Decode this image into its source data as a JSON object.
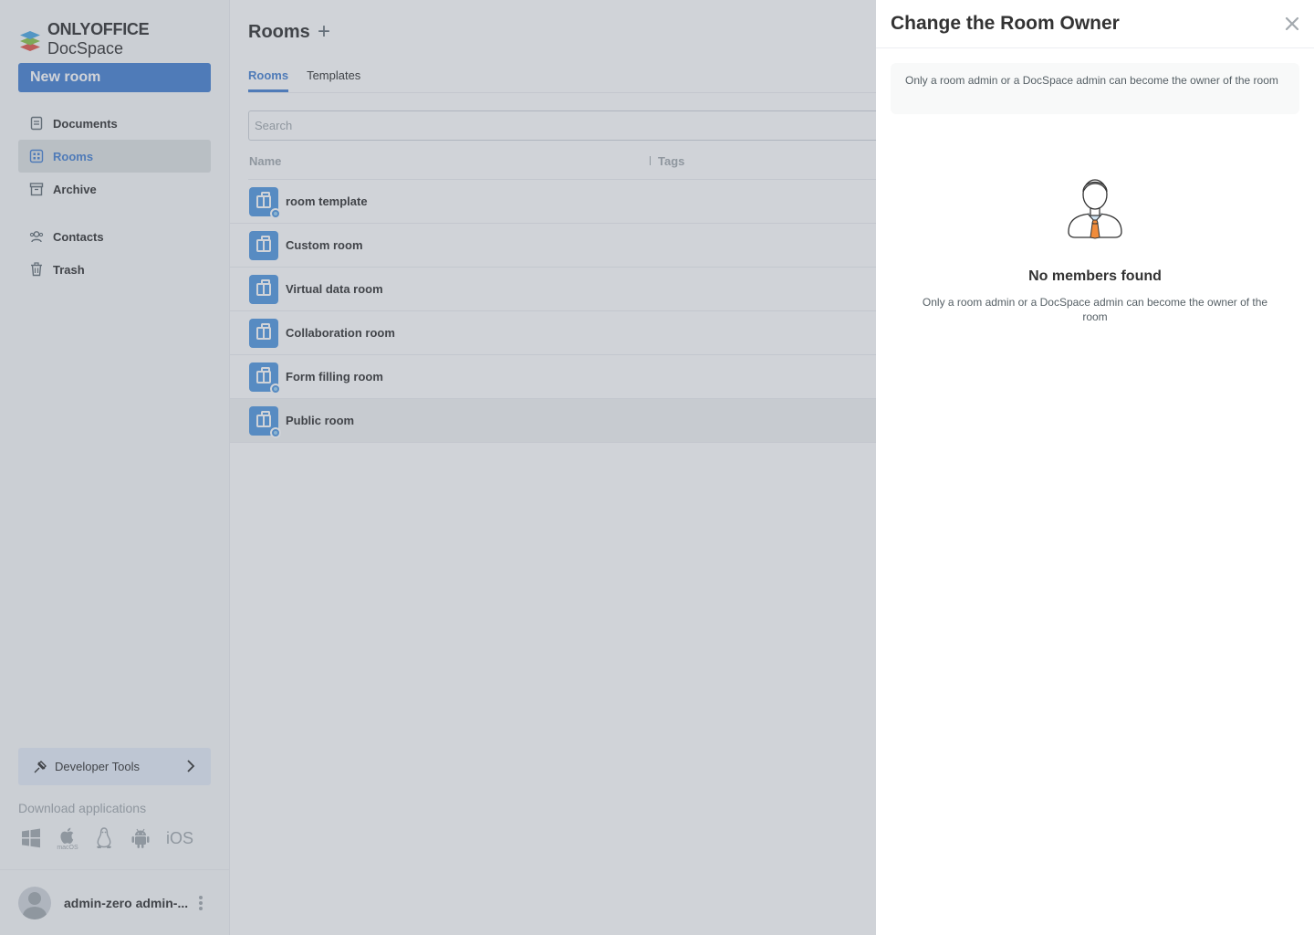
{
  "sidebar": {
    "logo_bold": "ONLYOFFICE",
    "logo_rest": " DocSpace",
    "new_room_label": "New room",
    "items": [
      {
        "label": "Documents",
        "icon": "document-icon"
      },
      {
        "label": "Rooms",
        "icon": "rooms-icon",
        "active": true
      },
      {
        "label": "Archive",
        "icon": "archive-icon"
      },
      {
        "label": "Contacts",
        "icon": "contacts-icon"
      },
      {
        "label": "Trash",
        "icon": "trash-icon"
      }
    ],
    "developer_tools_label": "Developer Tools",
    "download_label": "Download applications",
    "apps": [
      "windows-icon",
      "macos-icon",
      "linux-icon",
      "android-icon",
      "ios-icon"
    ],
    "macos_label": "macOS",
    "ios_label": "iOS",
    "profile_name": "admin-zero admin-..."
  },
  "main": {
    "title": "Rooms",
    "tabs": [
      {
        "label": "Rooms",
        "active": true
      },
      {
        "label": "Templates",
        "active": false
      }
    ],
    "search_placeholder": "Search",
    "columns": {
      "name": "Name",
      "tags": "Tags"
    },
    "rows": [
      {
        "name": "room template",
        "public": true
      },
      {
        "name": "Custom room",
        "public": false
      },
      {
        "name": "Virtual data room",
        "public": false
      },
      {
        "name": "Collaboration room",
        "public": false
      },
      {
        "name": "Form filling room",
        "public": true
      },
      {
        "name": "Public room",
        "public": true,
        "selected": true
      }
    ]
  },
  "panel": {
    "title": "Change the Room Owner",
    "info_text": "Only a room admin or a DocSpace admin can become the owner of the room",
    "empty_title": "No members found",
    "empty_text": "Only a room admin or a DocSpace admin can become the owner of the room"
  },
  "colors": {
    "accent": "#4781d1",
    "room_icon": "#5299e0",
    "overlay": "rgba(100,110,125,0.3)"
  }
}
